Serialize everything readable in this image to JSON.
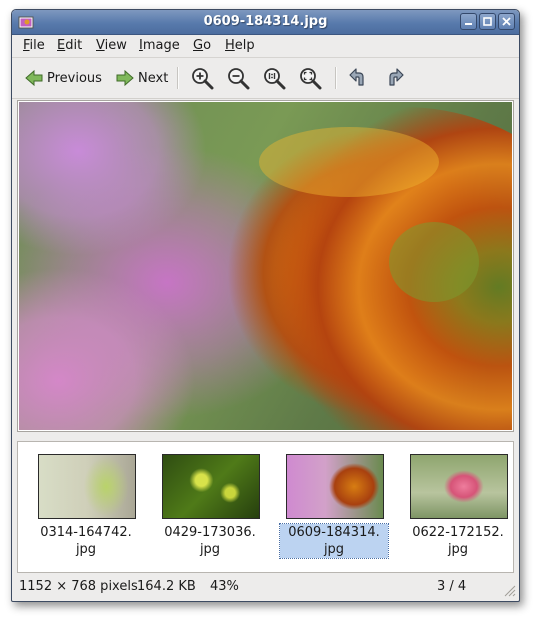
{
  "window": {
    "title": "0609-184314.jpg",
    "colors": {
      "titlebar": "#587aac",
      "selection": "#bcd3f1"
    }
  },
  "menu": [
    {
      "label": "File",
      "mnemonic": "F",
      "rest": "ile"
    },
    {
      "label": "Edit",
      "mnemonic": "E",
      "rest": "dit"
    },
    {
      "label": "View",
      "mnemonic": "V",
      "rest": "iew"
    },
    {
      "label": "Image",
      "mnemonic": "I",
      "rest": "mage"
    },
    {
      "label": "Go",
      "mnemonic": "G",
      "rest": "o"
    },
    {
      "label": "Help",
      "mnemonic": "H",
      "rest": "elp"
    }
  ],
  "toolbar": {
    "previous_label": "Previous",
    "next_label": "Next",
    "icons": [
      "zoom-in-icon",
      "zoom-out-icon",
      "zoom-normal-icon",
      "zoom-fit-icon",
      "rotate-left-icon",
      "rotate-right-icon"
    ]
  },
  "thumbnails": [
    {
      "line1": "0314-164742.",
      "line2": "jpg",
      "selected": false
    },
    {
      "line1": "0429-173036.",
      "line2": "jpg",
      "selected": false
    },
    {
      "line1": "0609-184314.",
      "line2": "jpg",
      "selected": true
    },
    {
      "line1": "0622-172152.",
      "line2": "jpg",
      "selected": false
    }
  ],
  "status": {
    "dimensions": "1152 × 768 pixels",
    "filesize": "164.2 KB",
    "zoom": "43%",
    "position": "3 / 4"
  }
}
